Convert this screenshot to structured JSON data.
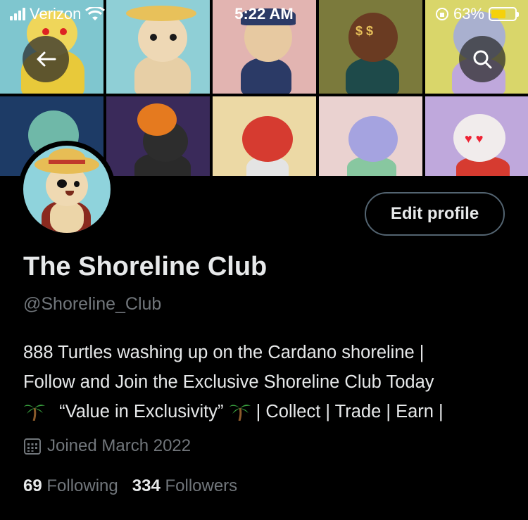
{
  "status_bar": {
    "carrier": "Verizon",
    "time": "5:22 AM",
    "battery_percent": "63%",
    "battery_level": 0.63,
    "battery_color": "#f5d10b"
  },
  "header": {
    "back_icon": "arrow-left-icon",
    "search_icon": "search-icon"
  },
  "profile": {
    "display_name": "The Shoreline Club",
    "handle": "@Shoreline_Club",
    "edit_button": "Edit profile",
    "bio_lines": [
      "888 Turtles washing up on the Cardano shoreline |",
      "Follow and Join the Exclusive Shoreline Club Today",
      "“Value in Exclusivity”",
      "| Collect | Trade | Earn |"
    ],
    "joined_icon": "calendar-icon",
    "joined": "Joined March 2022",
    "following_count": "69",
    "following_label": "Following",
    "followers_count": "334",
    "followers_label": "Followers"
  },
  "colors": {
    "background": "#000000",
    "text_primary": "#e7e9ea",
    "text_secondary": "#71767b",
    "button_border": "#536471"
  }
}
